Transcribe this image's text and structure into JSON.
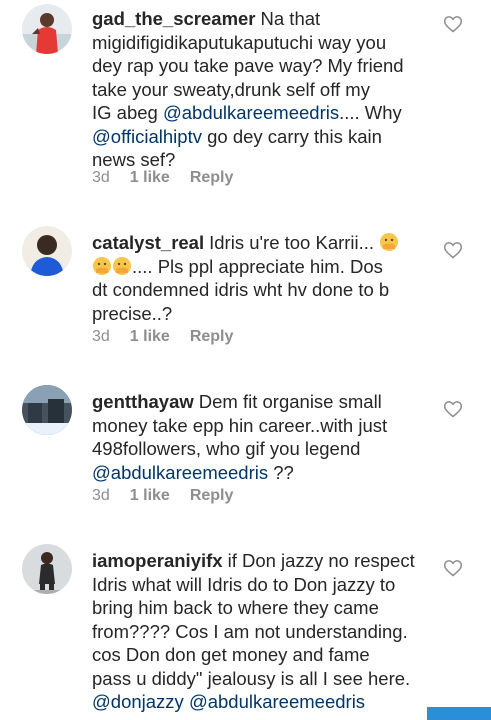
{
  "comments": [
    {
      "username": "gad_the_screamer",
      "lines": [
        "Na that",
        "migidifigidikaputukaputuchi way you",
        "dey rap you take pave way? My friend",
        "take your sweaty,drunk self off my",
        "IG abeg ",
        "@abdulkareemeedris",
        ".... Why",
        "@officialhiptv",
        " go dey carry this kain",
        "news sef?"
      ],
      "time": "3d",
      "likes": "1 like",
      "reply": "Reply"
    },
    {
      "username": "catalyst_real",
      "lines": [
        "Idris u're too Karrii...",
        ".... Pls ppl appreciate him.  Dos",
        "dt condemned idris wht hv done to b",
        "precise..?"
      ],
      "time": "3d",
      "likes": "1 like",
      "reply": "Reply"
    },
    {
      "username": "gentthayaw",
      "lines": [
        "Dem fit organise small",
        "money take epp hin career..with just",
        "498followers, who gif you legend",
        "@abdulkareemeedris",
        " ??"
      ],
      "time": "3d",
      "likes": "1 like",
      "reply": "Reply"
    },
    {
      "username": "iamoperaniyifx",
      "lines": [
        "if Don jazzy no respect",
        "Idris what will Idris do to Don jazzy to",
        "bring him back to where they came",
        "from???? Cos I am not understanding.",
        "cos Don don get money and fame",
        "pass u diddy\" jealousy is all I see here.",
        "@donjazzy",
        "@abdulkareemeedris"
      ]
    }
  ],
  "icons": {
    "like": "heart-outline-icon",
    "emoji": "face-with-hand-over-mouth-emoji"
  },
  "colors": {
    "mention": "#003569",
    "meta": "#8e8e8e",
    "text": "#262626"
  }
}
